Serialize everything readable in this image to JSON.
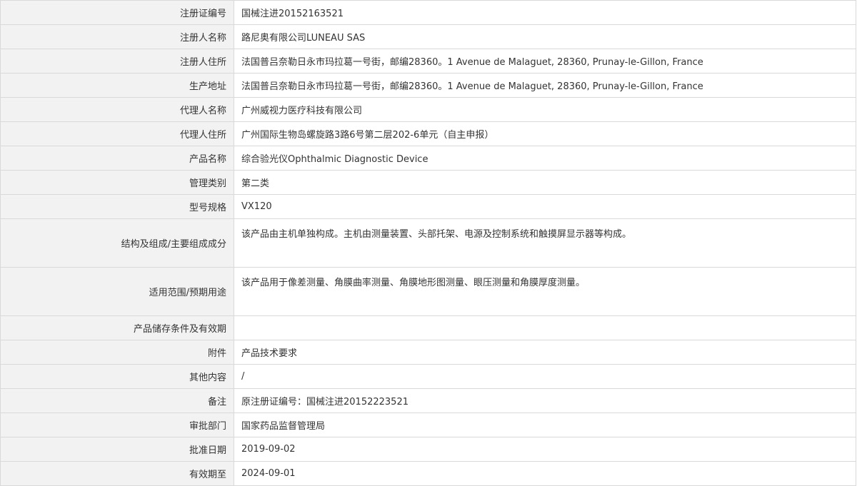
{
  "rows": [
    {
      "label": "注册证编号",
      "value": "国械注进20152163521"
    },
    {
      "label": "注册人名称",
      "value": "路尼奥有限公司LUNEAU SAS"
    },
    {
      "label": "注册人住所",
      "value": "法国普吕奈勒日永市玛拉葛一号街，邮编28360。1 Avenue de Malaguet, 28360, Prunay-le-Gillon, France"
    },
    {
      "label": "生产地址",
      "value": "法国普吕奈勒日永市玛拉葛一号街，邮编28360。1 Avenue de Malaguet, 28360, Prunay-le-Gillon, France"
    },
    {
      "label": "代理人名称",
      "value": "广州威视力医疗科技有限公司"
    },
    {
      "label": "代理人住所",
      "value": "广州国际生物岛螺旋路3路6号第二层202-6单元（自主申报）"
    },
    {
      "label": "产品名称",
      "value": "综合验光仪Ophthalmic Diagnostic Device"
    },
    {
      "label": "管理类别",
      "value": "第二类"
    },
    {
      "label": "型号规格",
      "value": "VX120"
    },
    {
      "label": "结构及组成/主要组成成分",
      "value": "该产品由主机单独构成。主机由测量装置、头部托架、电源及控制系统和触摸屏显示器等构成。"
    },
    {
      "label": "适用范围/预期用途",
      "value": "该产品用于像差测量、角膜曲率测量、角膜地形图测量、眼压测量和角膜厚度测量。"
    },
    {
      "label": "产品储存条件及有效期",
      "value": ""
    },
    {
      "label": "附件",
      "value": "产品技术要求"
    },
    {
      "label": "其他内容",
      "value": "/"
    },
    {
      "label": "备注",
      "value": "原注册证编号：国械注进20152223521"
    },
    {
      "label": "审批部门",
      "value": "国家药品监督管理局"
    },
    {
      "label": "批准日期",
      "value": "2019-09-02"
    },
    {
      "label": "有效期至",
      "value": "2024-09-01"
    }
  ]
}
